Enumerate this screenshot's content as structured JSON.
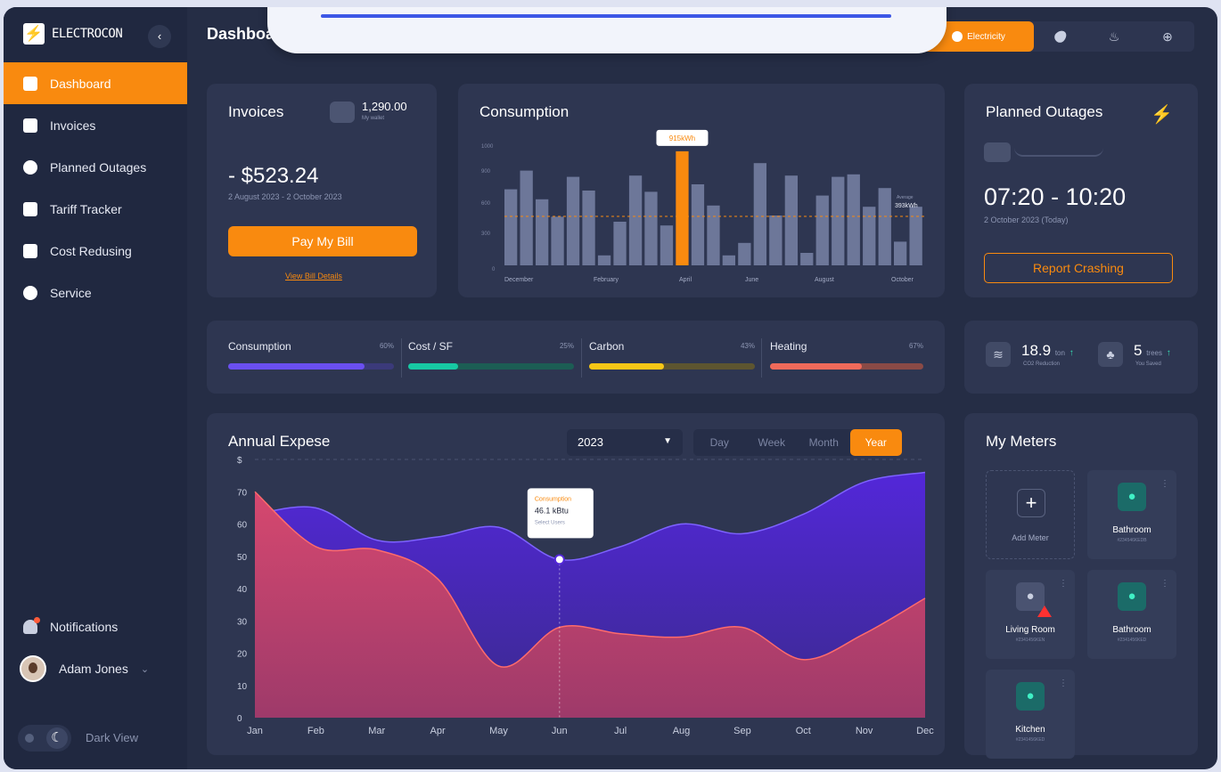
{
  "app": {
    "brand": "ELECTROCON",
    "brand_icon": "lightning-logo-icon",
    "page_title": "Dashboard"
  },
  "sidebar": {
    "items": [
      {
        "label": "Dashboard",
        "icon": "dashboard-icon",
        "active": true
      },
      {
        "label": "Invoices",
        "icon": "invoice-icon"
      },
      {
        "label": "Planned Outages",
        "icon": "outage-icon"
      },
      {
        "label": "Tariff Tracker",
        "icon": "tariff-icon"
      },
      {
        "label": "Cost Redusing",
        "icon": "cost-icon"
      },
      {
        "label": "Service",
        "icon": "gear-icon"
      }
    ],
    "notifications": "Notifications",
    "user": "Adam Jones",
    "dark_view": "Dark View"
  },
  "top_tabs": {
    "active": "Electricity",
    "others": [
      "water-icon",
      "gas-icon",
      "heating-icon"
    ]
  },
  "invoices": {
    "title": "Invoices",
    "wallet_amount": "1,290.00",
    "wallet_label": "My wallet",
    "amount": "- $523.24",
    "period": "2 August 2023 - 2 October 2023",
    "pay_button": "Pay My Bill",
    "details_link": "View Bill Details"
  },
  "consumption": {
    "title": "Consumption",
    "y_ticks": [
      "1000",
      "900",
      "600",
      "300",
      "0"
    ],
    "x_labels": [
      "December",
      "February",
      "April",
      "June",
      "August",
      "October"
    ],
    "highlight": "915kWh",
    "avg_label": "393kWh",
    "avg_sub": "Average"
  },
  "outages": {
    "title": "Planned Outages",
    "time": "07:20 - 10:20",
    "date": "2 October 2023 (Today)",
    "button": "Report Crashing"
  },
  "stats": [
    {
      "label": "Consumption",
      "pct": "60%",
      "value": 0.82,
      "color": "#6a4ff0",
      "track": "#3b3a7a"
    },
    {
      "label": "Cost / SF",
      "pct": "25%",
      "value": 0.3,
      "color": "#17c9a3",
      "track": "#1c5d54"
    },
    {
      "label": "Carbon",
      "pct": "43%",
      "value": 0.45,
      "color": "#f7c716",
      "track": "#5d5530"
    },
    {
      "label": "Heating",
      "pct": "67%",
      "value": 0.6,
      "color": "#f06a5a",
      "track": "#8a4a46"
    }
  ],
  "eco": {
    "co2_value": "18.9",
    "co2_unit": "ton",
    "co2_label": "CO2 Reduction",
    "trees_value": "5",
    "trees_unit": "trees",
    "trees_label": "You Saved"
  },
  "annual": {
    "title": "Annual Expese",
    "year": "2023",
    "periods": [
      "Day",
      "Week",
      "Month",
      "Year"
    ],
    "active_period": "Year",
    "tooltip": {
      "title": "Consumption",
      "value": "46.1 kBtu",
      "sub": "Select Users"
    }
  },
  "meters": {
    "title": "My Meters",
    "add_label": "Add Meter",
    "items": [
      {
        "name": "Bathroom",
        "id": "#234546KEDB",
        "status": "ok"
      },
      {
        "name": "Living Room",
        "id": "#2341456KEN",
        "status": "alert"
      },
      {
        "name": "Bathroom",
        "id": "#2341456KED",
        "status": "ok"
      },
      {
        "name": "Kitchen",
        "id": "#2341456KED",
        "status": "ok"
      }
    ]
  },
  "chart_data": [
    {
      "type": "bar",
      "title": "Consumption",
      "ylim": [
        0,
        1000
      ],
      "values": [
        610,
        760,
        530,
        390,
        710,
        600,
        80,
        350,
        720,
        590,
        320,
        915,
        650,
        480,
        80,
        180,
        820,
        400,
        720,
        100,
        560,
        710,
        730,
        470,
        620,
        190,
        470
      ],
      "highlight_index": 11,
      "average": 393,
      "x_tick_labels": [
        "December",
        "February",
        "April",
        "June",
        "August",
        "October"
      ]
    },
    {
      "type": "area",
      "title": "Annual Expese",
      "categories": [
        "Jan",
        "Feb",
        "Mar",
        "Apr",
        "May",
        "Jun",
        "Jul",
        "Aug",
        "Sep",
        "Oct",
        "Nov",
        "Dec"
      ],
      "ylim": [
        0,
        80
      ],
      "y_ticks": [
        "0",
        "10",
        "20",
        "30",
        "40",
        "50",
        "60",
        "70",
        "$"
      ],
      "series": [
        {
          "color": "#5128d6",
          "values": [
            63,
            65,
            55,
            56,
            59,
            49,
            53,
            60,
            57,
            63,
            73,
            76
          ]
        },
        {
          "color": "#d2496f",
          "values": [
            70,
            53,
            52,
            43,
            16,
            28,
            26,
            25,
            28,
            18,
            26,
            37
          ]
        }
      ]
    }
  ]
}
